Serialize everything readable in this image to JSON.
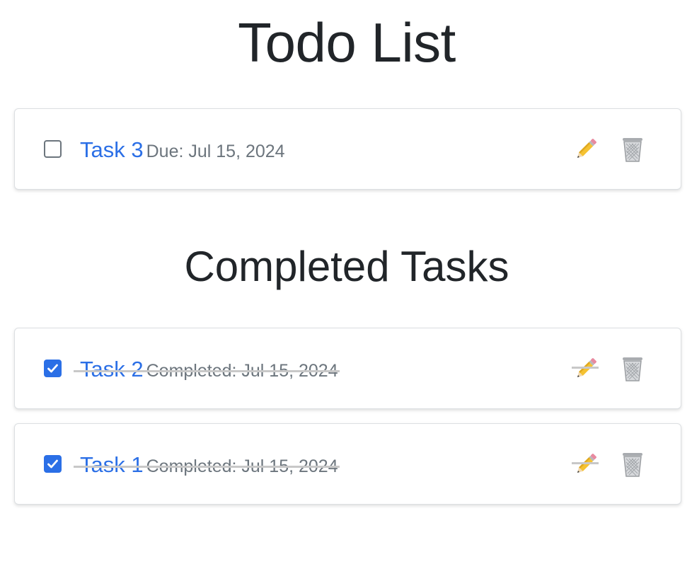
{
  "page": {
    "title": "Todo List",
    "completed_heading": "Completed Tasks"
  },
  "active_tasks": [
    {
      "name": "Task 3",
      "meta": "Due: Jul 15, 2024",
      "checked": false
    }
  ],
  "completed_tasks": [
    {
      "name": "Task 2",
      "meta": "Completed: Jul 15, 2024",
      "checked": true
    },
    {
      "name": "Task 1",
      "meta": "Completed: Jul 15, 2024",
      "checked": true
    }
  ],
  "icons": {
    "edit": "pencil-icon",
    "delete": "trash-icon",
    "check": "check-icon"
  },
  "colors": {
    "accent": "#2b6fe6",
    "muted": "#6c757d",
    "text": "#212529",
    "strike": "#c8c8c8"
  }
}
